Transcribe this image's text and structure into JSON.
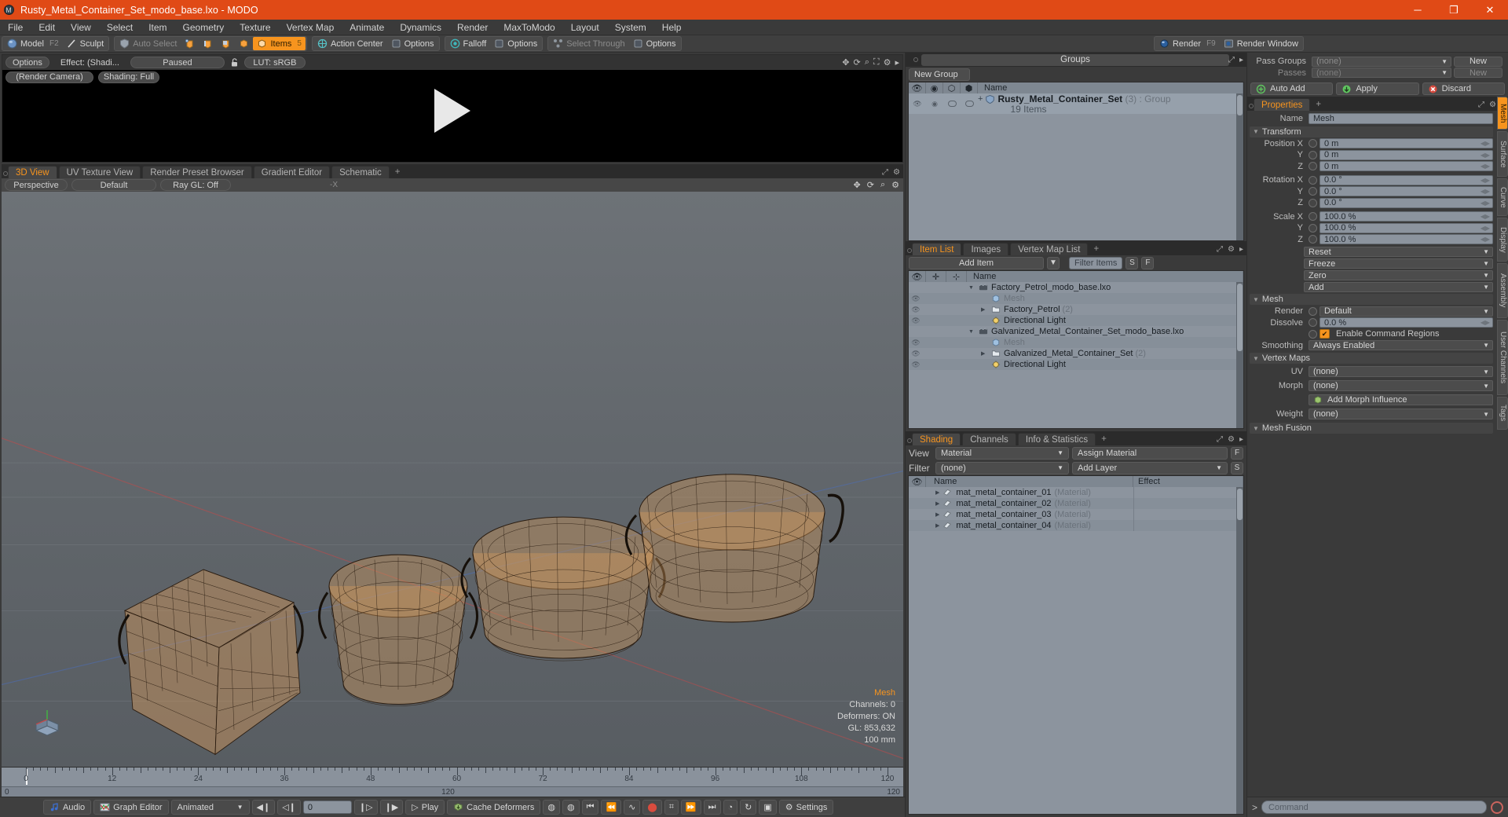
{
  "window": {
    "title": "Rusty_Metal_Container_Set_modo_base.lxo - MODO",
    "minimize": "─",
    "maximize": "❐",
    "close": "✕"
  },
  "menu": [
    "File",
    "Edit",
    "View",
    "Select",
    "Item",
    "Geometry",
    "Texture",
    "Vertex Map",
    "Animate",
    "Dynamics",
    "Render",
    "MaxToModo",
    "Layout",
    "System",
    "Help"
  ],
  "toolbar": {
    "mode_group": [
      {
        "label": "Model",
        "shortcut": "F2",
        "icon": "sphere-icon",
        "state": "normal"
      },
      {
        "label": "Sculpt",
        "shortcut": "",
        "icon": "brush-icon",
        "state": "normal"
      }
    ],
    "select_group": [
      {
        "label": "Auto Select",
        "icon": "shield-icon",
        "state": "dim"
      },
      {
        "label": "",
        "icon": "vertex-icon",
        "state": "normal"
      },
      {
        "label": "",
        "icon": "edge-icon",
        "state": "normal"
      },
      {
        "label": "",
        "icon": "polygon-icon",
        "state": "normal"
      },
      {
        "label": "",
        "icon": "material-icon",
        "state": "normal"
      },
      {
        "label": "Items",
        "shortcut": "5",
        "icon": "item-icon",
        "state": "active"
      }
    ],
    "center_group": [
      {
        "label": "Action Center",
        "icon": "action-center-icon",
        "state": "normal"
      },
      {
        "label": "Options",
        "icon": "options-icon",
        "state": "normal"
      }
    ],
    "falloff_group": [
      {
        "label": "Falloff",
        "icon": "falloff-icon",
        "state": "normal"
      },
      {
        "label": "Options",
        "icon": "options-icon",
        "state": "normal"
      }
    ],
    "through_group": [
      {
        "label": "Select Through",
        "icon": "select-through-icon",
        "state": "dim"
      },
      {
        "label": "Options",
        "icon": "options-icon",
        "state": "normal"
      }
    ],
    "render_group": [
      {
        "label": "Render",
        "shortcut": "F9",
        "icon": "render-ball-icon",
        "state": "normal"
      },
      {
        "label": "Render Window",
        "icon": "render-window-icon",
        "state": "normal"
      }
    ]
  },
  "preview": {
    "buttons": [
      "Options",
      "Effect: (Shadi...",
      "Paused"
    ],
    "lock_icon": "unlock-icon",
    "lut": "LUT: sRGB",
    "row2": [
      "(Render Camera)",
      "Shading: Full"
    ],
    "tool_icons": [
      "move-icon",
      "rotate-icon",
      "zoom-icon",
      "fit-icon",
      "gear-icon",
      "chevron-right-icon"
    ]
  },
  "viewport": {
    "tabs": [
      {
        "label": "3D View",
        "selected": true
      },
      {
        "label": "UV Texture View",
        "selected": false
      },
      {
        "label": "Render Preset Browser",
        "selected": false
      },
      {
        "label": "Gradient Editor",
        "selected": false
      },
      {
        "label": "Schematic",
        "selected": false
      }
    ],
    "tab_add": "+",
    "tools": [
      "Perspective",
      "Default",
      "Ray GL: Off"
    ],
    "axis_label": "-X",
    "right_icons": [
      "move-icon",
      "rotate-icon",
      "zoom-icon",
      "gear-icon"
    ],
    "stats": {
      "title": "Mesh",
      "channels": "Channels: 0",
      "deformers": "Deformers: ON",
      "gl": "GL: 853,632",
      "scale": "100 mm"
    }
  },
  "timeline": {
    "ticks": [
      "0",
      "12",
      "24",
      "36",
      "48",
      "60",
      "72",
      "84",
      "96",
      "108",
      "120"
    ],
    "strip_left": "0",
    "strip_center": "120",
    "strip_right": "120"
  },
  "bottom_bar": {
    "audio": "Audio",
    "graph_editor": "Graph Editor",
    "mode": "Animated",
    "frame_value": "0",
    "play": "Play",
    "cache_deformers": "Cache Deformers",
    "settings": "Settings",
    "transport": [
      "◀❘",
      "◁❘",
      "❘▷",
      "▶❘"
    ]
  },
  "groups_panel": {
    "title": "Groups",
    "new_group_button": "New Group",
    "columns": [
      "eye-icon",
      "camera-icon",
      "shade-icon",
      "render-icon",
      "Name"
    ],
    "rows": [
      {
        "expander": "+",
        "icon": "group-icon",
        "name": "Rusty_Metal_Container_Set",
        "count": "(3)",
        "type": ": Group",
        "subtitle": "19 Items"
      }
    ]
  },
  "item_list_panel": {
    "tabs": [
      {
        "label": "Item List",
        "selected": true
      },
      {
        "label": "Images",
        "selected": false
      },
      {
        "label": "Vertex Map List",
        "selected": false
      }
    ],
    "tab_add": "+",
    "add_item_button": "Add Item",
    "filter_placeholder": "Filter Items",
    "btn_s": "S",
    "btn_f": "F",
    "columns": [
      "eye-icon",
      "add-icon",
      "axis-icon",
      "Name"
    ],
    "rows": [
      {
        "indent": 0,
        "expander": "▼",
        "icon": "scene-icon",
        "name": "Factory_Petrol_modo_base.lxo",
        "suffix": "",
        "eye": false,
        "dim": false
      },
      {
        "indent": 1,
        "expander": "",
        "icon": "mesh-icon",
        "name": "Mesh",
        "suffix": "",
        "eye": true,
        "dim": true
      },
      {
        "indent": 1,
        "expander": "▶",
        "icon": "folder-icon",
        "name": "Factory_Petrol",
        "suffix": "(2)",
        "eye": true,
        "dim": false
      },
      {
        "indent": 1,
        "expander": "",
        "icon": "light-icon",
        "name": "Directional Light",
        "suffix": "",
        "eye": true,
        "dim": false
      },
      {
        "indent": 0,
        "expander": "▼",
        "icon": "scene-icon",
        "name": "Galvanized_Metal_Container_Set_modo_base.lxo",
        "suffix": "",
        "eye": false,
        "dim": false
      },
      {
        "indent": 1,
        "expander": "",
        "icon": "mesh-icon",
        "name": "Mesh",
        "suffix": "",
        "eye": true,
        "dim": true
      },
      {
        "indent": 1,
        "expander": "▶",
        "icon": "folder-icon",
        "name": "Galvanized_Metal_Container_Set",
        "suffix": "(2)",
        "eye": true,
        "dim": false
      },
      {
        "indent": 1,
        "expander": "",
        "icon": "light-icon",
        "name": "Directional Light",
        "suffix": "",
        "eye": true,
        "dim": false
      }
    ]
  },
  "shading_panel": {
    "tabs": [
      {
        "label": "Shading",
        "selected": true
      },
      {
        "label": "Channels",
        "selected": false
      },
      {
        "label": "Info & Statistics",
        "selected": false
      }
    ],
    "tab_add": "+",
    "view_label": "View",
    "view_value": "Material",
    "assign_material": "Assign Material",
    "btn_f": "F",
    "filter_label": "Filter",
    "filter_value": "(none)",
    "add_layer": "Add Layer",
    "btn_s": "S",
    "columns": [
      "eye-icon",
      "Name",
      "Effect"
    ],
    "rows": [
      {
        "name": "mat_metal_container_01",
        "type": "(Material)",
        "effect": ""
      },
      {
        "name": "mat_metal_container_02",
        "type": "(Material)",
        "effect": ""
      },
      {
        "name": "mat_metal_container_03",
        "type": "(Material)",
        "effect": ""
      },
      {
        "name": "mat_metal_container_04",
        "type": "(Material)",
        "effect": ""
      }
    ]
  },
  "passes_panel": {
    "pass_groups_label": "Pass Groups",
    "pass_groups_value": "(none)",
    "pass_groups_new": "New",
    "passes_label": "Passes",
    "passes_value": "(none)",
    "passes_new": "New",
    "auto_add": "Auto Add",
    "apply": "Apply",
    "discard": "Discard"
  },
  "properties_panel": {
    "tabs": [
      {
        "label": "Properties",
        "selected": true
      }
    ],
    "tab_add": "+",
    "name_label": "Name",
    "name_value": "Mesh",
    "sections": {
      "transform": {
        "title": "Transform",
        "fields": [
          {
            "label": "Position X",
            "value": "0 m"
          },
          {
            "label": "Y",
            "value": "0 m"
          },
          {
            "label": "Z",
            "value": "0 m"
          },
          {
            "label": "Rotation X",
            "value": "0.0 °"
          },
          {
            "label": "Y",
            "value": "0.0 °"
          },
          {
            "label": "Z",
            "value": "0.0 °"
          },
          {
            "label": "Scale X",
            "value": "100.0 %"
          },
          {
            "label": "Y",
            "value": "100.0 %"
          },
          {
            "label": "Z",
            "value": "100.0 %"
          }
        ],
        "dropdowns": [
          "Reset",
          "Freeze",
          "Zero",
          "Add"
        ]
      },
      "mesh": {
        "title": "Mesh",
        "render_label": "Render",
        "render_value": "Default",
        "dissolve_label": "Dissolve",
        "dissolve_value": "0.0 %",
        "enable_command_regions": "Enable Command Regions",
        "enable_command_regions_checked": true,
        "smoothing_label": "Smoothing",
        "smoothing_value": "Always Enabled"
      },
      "vertex_maps": {
        "title": "Vertex Maps",
        "uv_label": "UV",
        "uv_value": "(none)",
        "morph_label": "Morph",
        "morph_value": "(none)",
        "add_morph_influence": "Add Morph Influence",
        "weight_label": "Weight",
        "weight_value": "(none)"
      },
      "mesh_fusion": {
        "title": "Mesh Fusion"
      }
    },
    "vertical_tabs": [
      {
        "label": "Mesh",
        "selected": true
      },
      {
        "label": "Surface",
        "selected": false
      },
      {
        "label": "Curve",
        "selected": false
      },
      {
        "label": "Display",
        "selected": false
      },
      {
        "label": "Assembly",
        "selected": false
      },
      {
        "label": "User Channels",
        "selected": false
      },
      {
        "label": "Tags",
        "selected": false
      }
    ]
  },
  "command_bar": {
    "prompt": ">",
    "placeholder": "Command"
  },
  "colors": {
    "title_bar": "#e04a16",
    "accent": "#f7941e",
    "panel_bg": "#3a3a3a",
    "list_bg": "#8c949e",
    "viewport_top": "#6d7277"
  }
}
